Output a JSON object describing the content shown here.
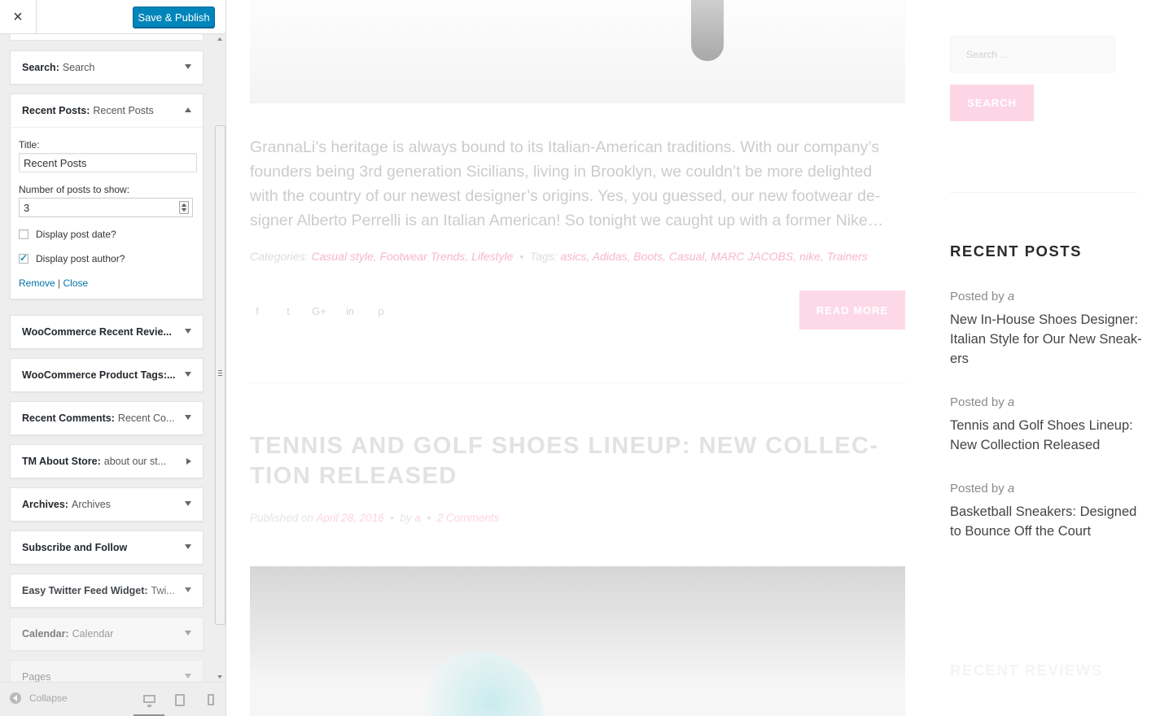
{
  "customizer": {
    "close_glyph": "×",
    "save_label": "Save & Publish",
    "widgets": {
      "search": {
        "type": "Search:",
        "title": "Search"
      },
      "recent_posts": {
        "type": "Recent Posts:",
        "title": "Recent Posts",
        "title_label": "Title:",
        "title_value": "Recent Posts",
        "number_label": "Number of posts to show:",
        "number_value": "3",
        "display_date_label": "Display post date?",
        "display_date_checked": false,
        "display_author_label": "Display post author?",
        "display_author_checked": true,
        "remove_label": "Remove",
        "link_separator": "|",
        "close_label": "Close"
      },
      "woo_reviews": {
        "type": "WooCommerce Recent Revie...",
        "title": ""
      },
      "woo_tags": {
        "type": "WooCommerce Product Tags:...",
        "title": ""
      },
      "recent_comments": {
        "type": "Recent Comments:",
        "title": "Recent Co..."
      },
      "about_store": {
        "type": "TM About Store:",
        "title": "about our st..."
      },
      "archives": {
        "type": "Archives:",
        "title": "Archives"
      },
      "subscribe": {
        "type": "Subscribe and Follow",
        "title": ""
      },
      "twitter": {
        "type": "Easy Twitter Feed Widget:",
        "title": "Twi..."
      },
      "calendar": {
        "type": "Calendar:",
        "title": "Calendar"
      },
      "pages": {
        "type": "Pages",
        "title": ""
      }
    },
    "footer": {
      "collapse_label": "Collapse",
      "devices": [
        "desktop-icon",
        "tablet-icon",
        "mobile-icon"
      ]
    }
  },
  "preview": {
    "excerpt": "GrannaLi’s heritage is always bound to its Italian-American traditions. With our company’s founders being 3rd generation Sicilians, living in Brooklyn, we couldn’t be more delighted with the country of our newest designer’s origins. Yes, you guessed, our new footwear de-signer Alberto Perrelli is an Italian American! So tonight we caught up with a former Nike…",
    "categories_label": "Categories:",
    "categories": "Casual style, Footwear Trends, Lifestyle",
    "tags_label": "Tags:",
    "tags": "asics, Adidas, Boots, Casual, MARC JACOBS, nike, Trainers",
    "meta_dot": "•",
    "social_icons": [
      "f",
      "t",
      "G+",
      "in",
      "p"
    ],
    "read_more": "READ MORE",
    "post2_title": "TENNIS AND GOLF SHOES LINEUP: NEW COLLEC-TION RELEASED",
    "post2_published": "Published on",
    "post2_date": "April 28, 2016",
    "post2_by": "by",
    "post2_author": "a",
    "post2_comments": "2 Comments",
    "sidebar": {
      "search_placeholder": "Search ...",
      "search_button": "SEARCH",
      "recent_posts_heading": "RECENT POSTS",
      "posted_by": "Posted by",
      "author": "a",
      "posts": [
        "New In-House Shoes Designer: Italian Style for Our New Sneak-ers",
        "Tennis and Golf Shoes Lineup: New Collection Released",
        "Basketball Sneakers: Designed to Bounce Off the Court"
      ],
      "recent_reviews_heading": "RECENT REVIEWS"
    }
  },
  "colors": {
    "accent_blue": "#0085ba",
    "pink": "#fdd6e6",
    "link": "#0073aa"
  }
}
